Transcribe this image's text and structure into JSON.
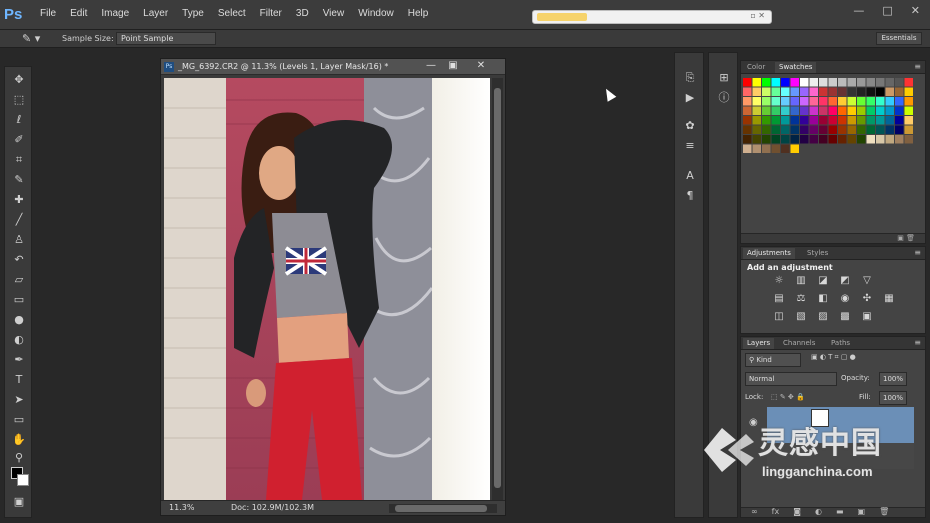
{
  "app": {
    "logo": "Ps",
    "menu": [
      "File",
      "Edit",
      "Image",
      "Layer",
      "Type",
      "Select",
      "Filter",
      "3D",
      "View",
      "Window",
      "Help"
    ],
    "window_controls": [
      "—",
      "□",
      "✕"
    ]
  },
  "options_bar": {
    "sample_size_label": "Sample Size:",
    "sample_size_value": "Point Sample",
    "workspace": "Essentials"
  },
  "document": {
    "title": "_MG_6392.CR2 @ 11.3% (Levels 1, Layer Mask/16) *",
    "zoom": "11.3%",
    "doc_info": "Doc: 102.9M/102.3M"
  },
  "panels": {
    "color_tabs": [
      "Color",
      "Swatches"
    ],
    "adjustments_tabs": [
      "Adjustments",
      "Styles"
    ],
    "adjustments_title": "Add an adjustment",
    "layers_tabs": [
      "Layers",
      "Channels",
      "Paths"
    ],
    "kind_value": "Kind",
    "blend_mode": "Normal",
    "opacity_label": "Opacity:",
    "opacity_value": "100%",
    "lock_label": "Lock:",
    "fill_label": "Fill:",
    "fill_value": "100%"
  },
  "swatches": [
    [
      "#ff0000",
      "#ffff00",
      "#00ff00",
      "#00ffff",
      "#0000ff",
      "#ff00ff",
      "#ffffff",
      "#eeeeee",
      "#dddddd",
      "#cccccc",
      "#bbbbbb",
      "#aaaaaa",
      "#999999",
      "#888888",
      "#777777",
      "#666666",
      "#555555",
      "#ff3333"
    ],
    [
      "#ff6666",
      "#ffcc66",
      "#ccff66",
      "#66ff99",
      "#66ffff",
      "#6699ff",
      "#9966ff",
      "#ff66cc",
      "#cc3333",
      "#993333",
      "#663333",
      "#333333",
      "#222222",
      "#111111",
      "#000000",
      "#cc9966",
      "#996633",
      "#ffcc00"
    ],
    [
      "#ff9966",
      "#ffff66",
      "#99ff66",
      "#66ffcc",
      "#66ccff",
      "#6666ff",
      "#cc66ff",
      "#ff6699",
      "#ff3366",
      "#ff6633",
      "#ffcc33",
      "#ccff33",
      "#66ff33",
      "#33ff66",
      "#33ffcc",
      "#33ccff",
      "#3366ff",
      "#ff9900"
    ],
    [
      "#cc6633",
      "#cccc33",
      "#66cc33",
      "#33cc66",
      "#33cccc",
      "#3366cc",
      "#6633cc",
      "#cc33cc",
      "#cc3366",
      "#ff0066",
      "#ff6600",
      "#ffcc00",
      "#99cc00",
      "#00cc66",
      "#00cccc",
      "#0099cc",
      "#0033cc",
      "#ccff00"
    ],
    [
      "#993300",
      "#999900",
      "#339900",
      "#009933",
      "#009999",
      "#003399",
      "#330099",
      "#990099",
      "#990033",
      "#cc0033",
      "#cc3300",
      "#cc9900",
      "#669900",
      "#009966",
      "#009999",
      "#006699",
      "#000099",
      "#ffcc66"
    ],
    [
      "#663300",
      "#666600",
      "#336600",
      "#006633",
      "#006666",
      "#003366",
      "#330066",
      "#660066",
      "#660033",
      "#990000",
      "#993300",
      "#996600",
      "#336600",
      "#006633",
      "#005555",
      "#003366",
      "#000066",
      "#cc9933"
    ],
    [
      "#442200",
      "#444400",
      "#224400",
      "#004422",
      "#004444",
      "#002244",
      "#220044",
      "#440044",
      "#440022",
      "#660000",
      "#662200",
      "#664400",
      "#224400",
      "#f0e0c0",
      "#d8c8a8",
      "#c0a880",
      "#a08060",
      "#806040"
    ],
    [
      "#d0b090",
      "#b09070",
      "#907050",
      "#705030",
      "#503020",
      "#ffcc00"
    ]
  ],
  "watermark": {
    "main": "灵感中国",
    "sub": "lingganchina.com"
  }
}
